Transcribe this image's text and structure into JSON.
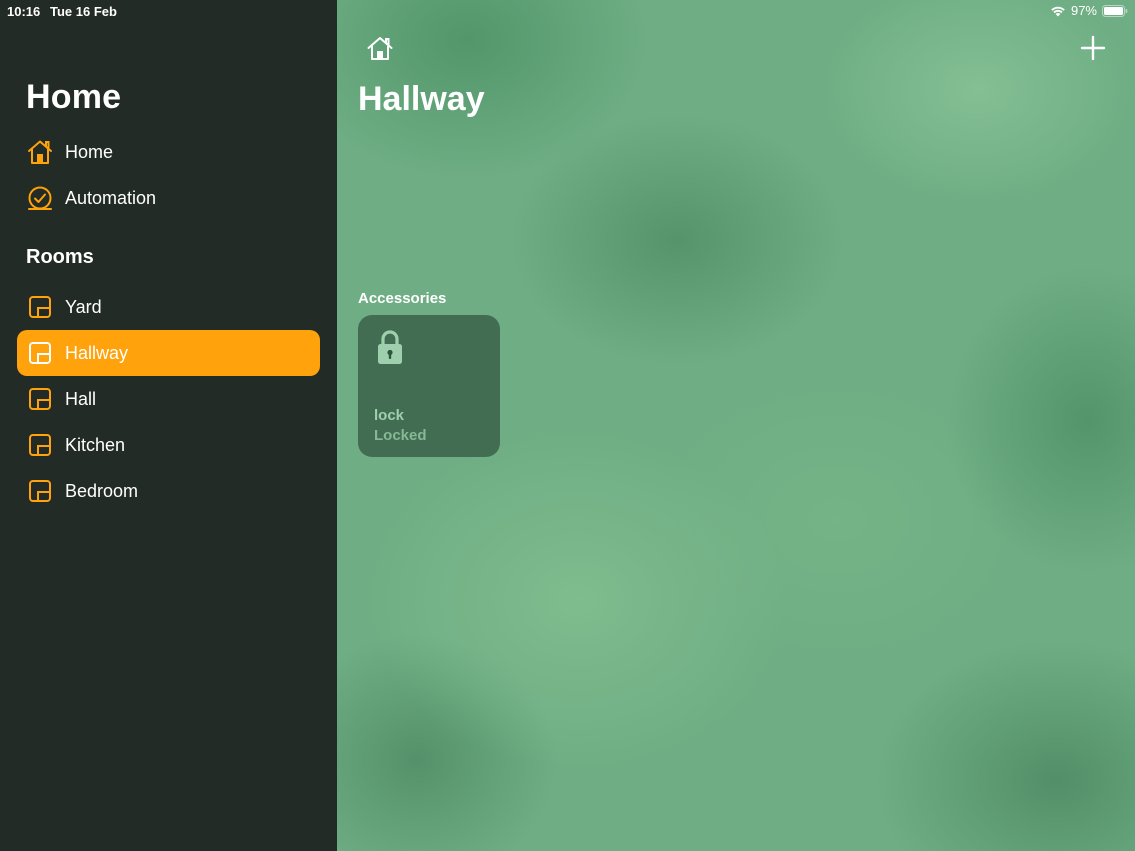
{
  "status_bar": {
    "time": "10:16",
    "date": "Tue 16 Feb",
    "battery": "97%",
    "wifi_icon": "wifi-icon",
    "battery_icon": "battery-icon"
  },
  "sidebar": {
    "title": "Home",
    "nav": [
      {
        "label": "Home",
        "icon": "house-icon"
      },
      {
        "label": "Automation",
        "icon": "clock-icon"
      }
    ],
    "rooms_title": "Rooms",
    "rooms": [
      {
        "label": "Yard",
        "icon": "room-icon"
      },
      {
        "label": "Hallway",
        "icon": "room-icon",
        "selected": true
      },
      {
        "label": "Hall",
        "icon": "room-icon"
      },
      {
        "label": "Kitchen",
        "icon": "room-icon"
      },
      {
        "label": "Bedroom",
        "icon": "room-icon"
      }
    ]
  },
  "main": {
    "home_button_icon": "house-icon",
    "add_button_icon": "plus-icon",
    "title": "Hallway",
    "accessories_title": "Accessories",
    "accessories": [
      {
        "name": "lock",
        "state": "Locked",
        "icon": "lock-icon"
      }
    ]
  },
  "colors": {
    "accent": "#ffa20b",
    "sidebar_bg": "#222b26",
    "main_bg": "#6fae84"
  }
}
